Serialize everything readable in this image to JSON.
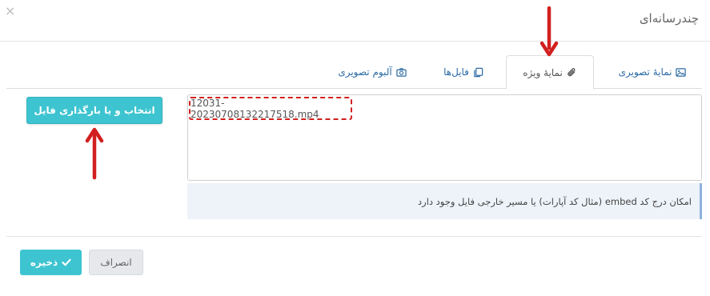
{
  "modal": {
    "title": "چندرسانه‌ای",
    "close_glyph": "×"
  },
  "tabs": [
    {
      "label": "نمایهٔ تصویری",
      "icon": "image-icon",
      "active": false
    },
    {
      "label": "نمایهٔ ویژه",
      "icon": "paperclip-icon",
      "active": true
    },
    {
      "label": "فایل‌ها",
      "icon": "files-icon",
      "active": false
    },
    {
      "label": "آلبوم تصویری",
      "icon": "camera-icon",
      "active": false
    }
  ],
  "media": {
    "file_value": "12031-20230708132217518.mp4",
    "help_text": "امکان درج کد embed (مثال کد آپارات) یا مسیر خارجی فایل وجود دارد",
    "upload_label": "انتخاب و یا بارگذاری فایل"
  },
  "footer": {
    "save_label": "ذخیره",
    "cancel_label": "انصراف"
  },
  "colors": {
    "accent": "#3dc4d0",
    "annotation_red": "#d21f1f",
    "tab_link": "#2b6aa3"
  }
}
